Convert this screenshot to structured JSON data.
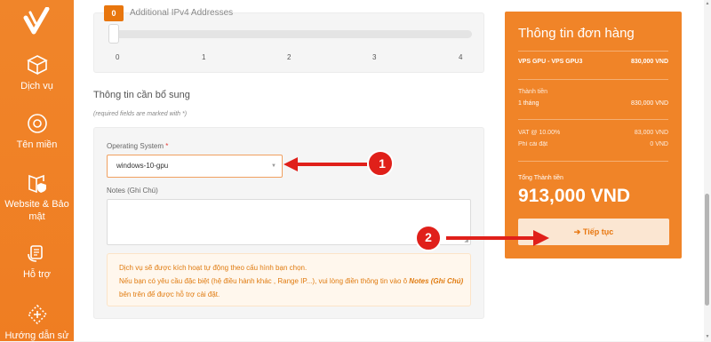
{
  "sidebar": {
    "items": [
      {
        "label": "Dịch vụ",
        "icon": "box-icon"
      },
      {
        "label": "Tên miền",
        "icon": "globe-icon"
      },
      {
        "label": "Website & Bảo mật",
        "icon": "book-shield-icon"
      },
      {
        "label": "Hỗ trợ",
        "icon": "support-icon"
      },
      {
        "label": "Hướng dẫn sử",
        "icon": "guide-icon"
      }
    ]
  },
  "slider": {
    "cut_label": "Additional IPv4 Addresses",
    "value": "0",
    "ticks": [
      "0",
      "1",
      "2",
      "3",
      "4"
    ]
  },
  "form": {
    "section_title": "Thông tin cần bổ sung",
    "required_note": "(required fields are marked with *)",
    "os_label": "Operating System",
    "required_mark": "*",
    "os_value": "windows-10-gpu",
    "notes_label": "Notes (Ghi Chú)",
    "notes_value": "",
    "notice_line1": "Dịch vụ sẽ được kích hoạt tự động theo cấu hình bạn chọn.",
    "notice_line2a": "Nếu bạn có yêu cầu đặc biệt (hệ điều hành khác , Range IP...), vui lòng điền thông tin vào ô ",
    "notice_bold": "Notes (Ghi Chú)",
    "notice_line2b": " bên trên để được hỗ trợ cài đặt."
  },
  "order": {
    "title": "Thông tin đơn hàng",
    "product_name": "VPS GPU - VPS GPU3",
    "product_price": "830,000 VND",
    "subtotal_label": "Thành tiền",
    "period": "1 tháng",
    "period_price": "830,000 VND",
    "vat_label": "VAT @ 10.00%",
    "vat_value": "83,000 VND",
    "setup_label": "Phí cài đặt",
    "setup_value": "0 VND",
    "total_label": "Tổng Thành tiền",
    "total_value": "913,000 VND",
    "continue_label": "Tiếp tục"
  },
  "annotations": {
    "step1": "1",
    "step2": "2"
  },
  "colors": {
    "accent": "#f08428",
    "annotation_red": "#e0201a",
    "sidebar": "#ef7d22"
  }
}
